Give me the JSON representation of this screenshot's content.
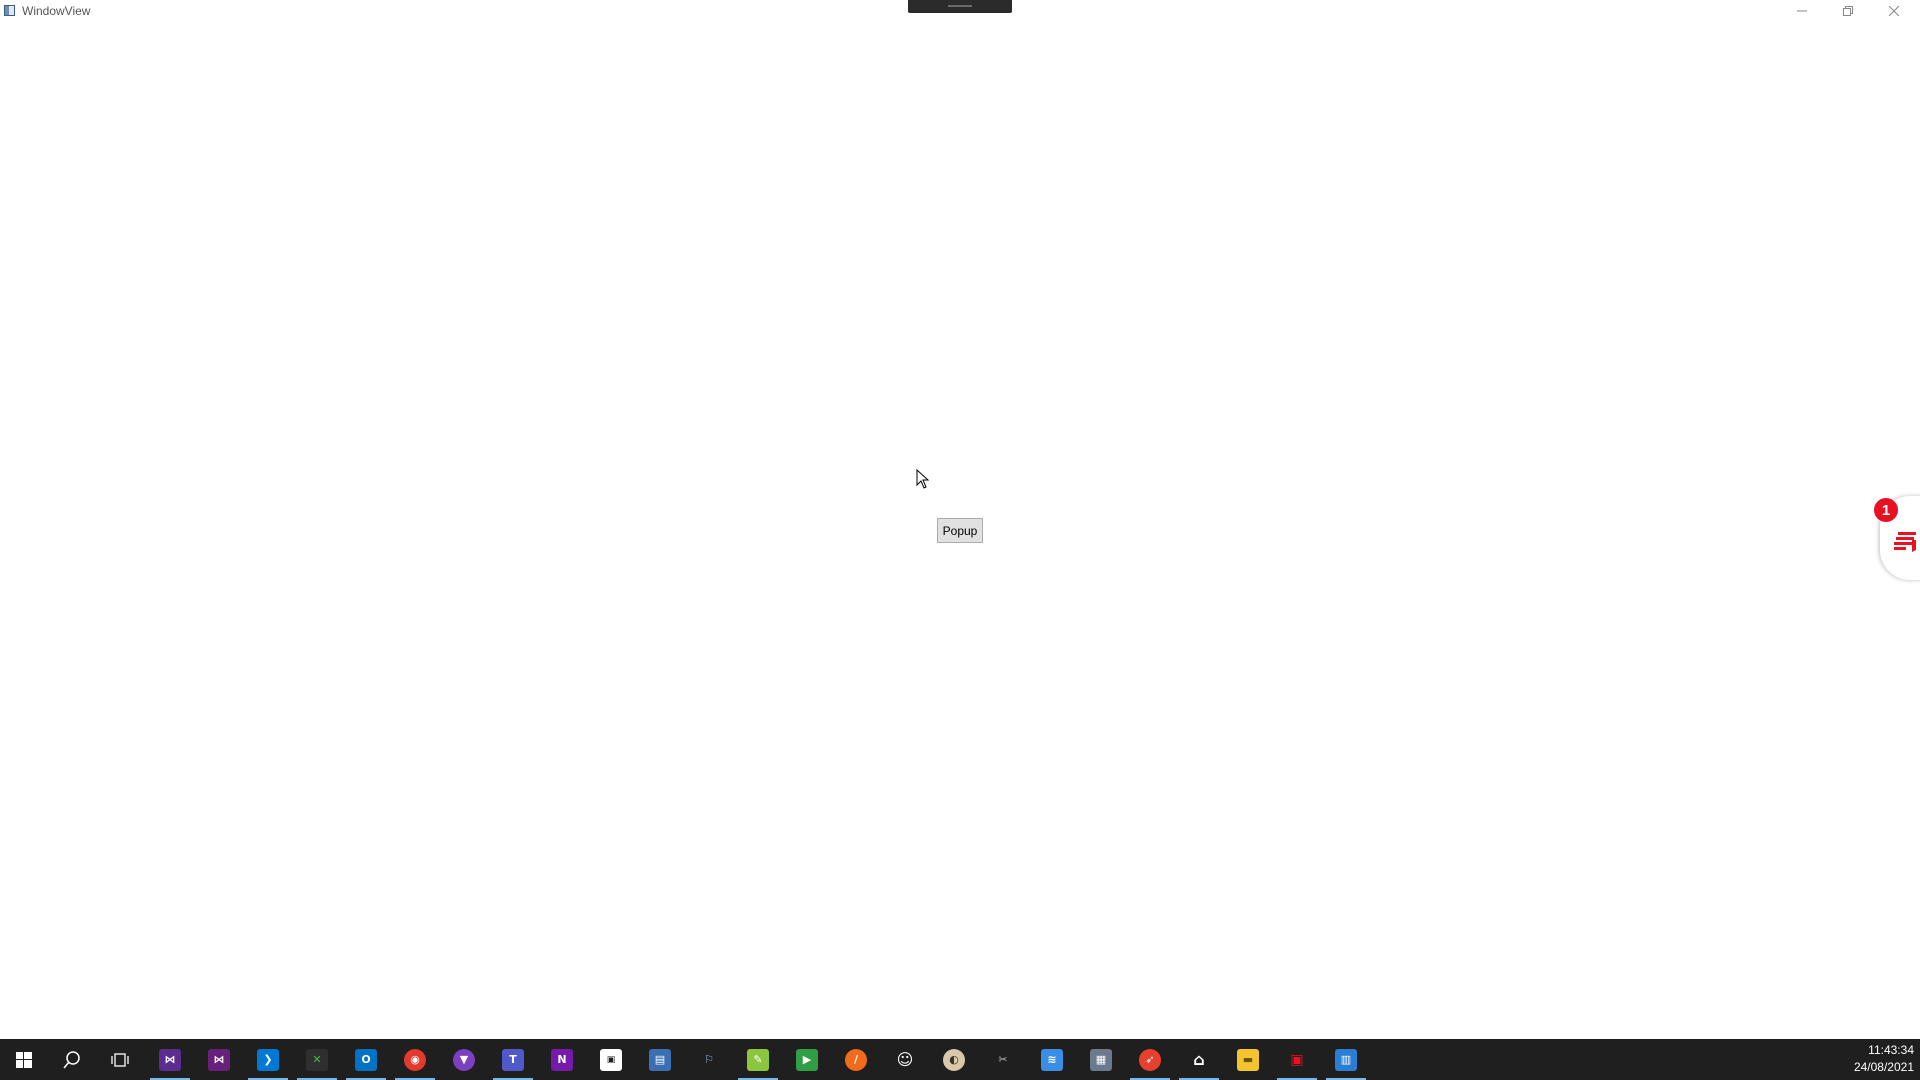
{
  "window": {
    "title": "WindowView",
    "popup_label": "Popup"
  },
  "caption_buttons": {
    "minimize_icon": "minimize-icon",
    "restore_icon": "restore-icon",
    "close_icon": "close-icon"
  },
  "side_panel": {
    "badge_count": "1",
    "icon": "chat-notes-icon",
    "accent_color": "#e81123"
  },
  "taskbar": {
    "icons": [
      {
        "name": "start-icon"
      },
      {
        "name": "search-icon"
      },
      {
        "name": "task-view-icon"
      },
      {
        "name": "visual-studio-icon",
        "active": true
      },
      {
        "name": "visual-studio-alt-icon"
      },
      {
        "name": "vscode-icon",
        "active": true
      },
      {
        "name": "git-icon",
        "active": true
      },
      {
        "name": "outlook-icon",
        "active": true
      },
      {
        "name": "app-red-icon",
        "active": true
      },
      {
        "name": "brave-icon"
      },
      {
        "name": "teams-icon",
        "active": true
      },
      {
        "name": "onenote-icon"
      },
      {
        "name": "app-terminal-icon"
      },
      {
        "name": "app-remote-icon"
      },
      {
        "name": "network-icon"
      },
      {
        "name": "notepad-icon",
        "active": true
      },
      {
        "name": "media-player-icon"
      },
      {
        "name": "orange-app-icon"
      },
      {
        "name": "emoji-icon"
      },
      {
        "name": "paint-icon"
      },
      {
        "name": "snipping-tool-icon"
      },
      {
        "name": "stack-app-icon"
      },
      {
        "name": "photos-icon"
      },
      {
        "name": "swift-icon",
        "active": true
      },
      {
        "name": "home-icon",
        "active": true
      },
      {
        "name": "folder-icon"
      },
      {
        "name": "pdf-icon",
        "active": true
      },
      {
        "name": "window-app-icon",
        "active": true
      }
    ],
    "time": "11:43:34",
    "date": "24/08/2021"
  }
}
